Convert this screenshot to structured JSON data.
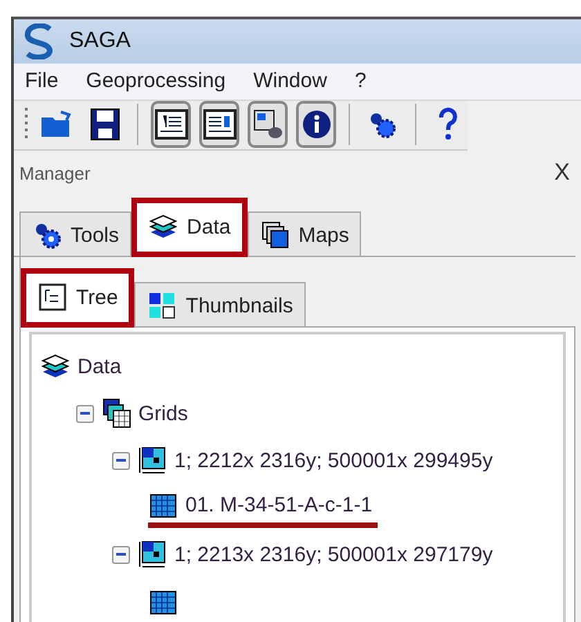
{
  "window": {
    "title": "SAGA"
  },
  "menu": [
    "File",
    "Geoprocessing",
    "Window",
    "?"
  ],
  "manager": {
    "title": "Manager",
    "close": "X"
  },
  "tabs": [
    {
      "label": "Tools",
      "kind": "tools",
      "selected": false,
      "highlighted": false
    },
    {
      "label": "Data",
      "kind": "data",
      "selected": true,
      "highlighted": true
    },
    {
      "label": "Maps",
      "kind": "maps",
      "selected": false,
      "highlighted": false
    }
  ],
  "subtabs": [
    {
      "label": "Tree",
      "kind": "tree",
      "selected": true,
      "highlighted": true
    },
    {
      "label": "Thumbnails",
      "kind": "thumbs",
      "selected": false,
      "highlighted": false
    }
  ],
  "tree": [
    {
      "label": "Data",
      "kind": "data",
      "children": [
        {
          "label": "Grids",
          "kind": "grids",
          "expanded": true,
          "children": [
            {
              "label": "1; 2212x 2316y; 500001x 299495y",
              "kind": "system",
              "expanded": true,
              "children": [
                {
                  "label": "01. M-34-51-A-c-1-1",
                  "kind": "grid",
                  "underlined": true
                }
              ]
            },
            {
              "label": "1; 2213x 2316y; 500001x 297179y",
              "kind": "system",
              "expanded": true,
              "children": [
                {
                  "kind": "grid",
                  "underlined": false
                }
              ]
            }
          ]
        }
      ]
    }
  ]
}
